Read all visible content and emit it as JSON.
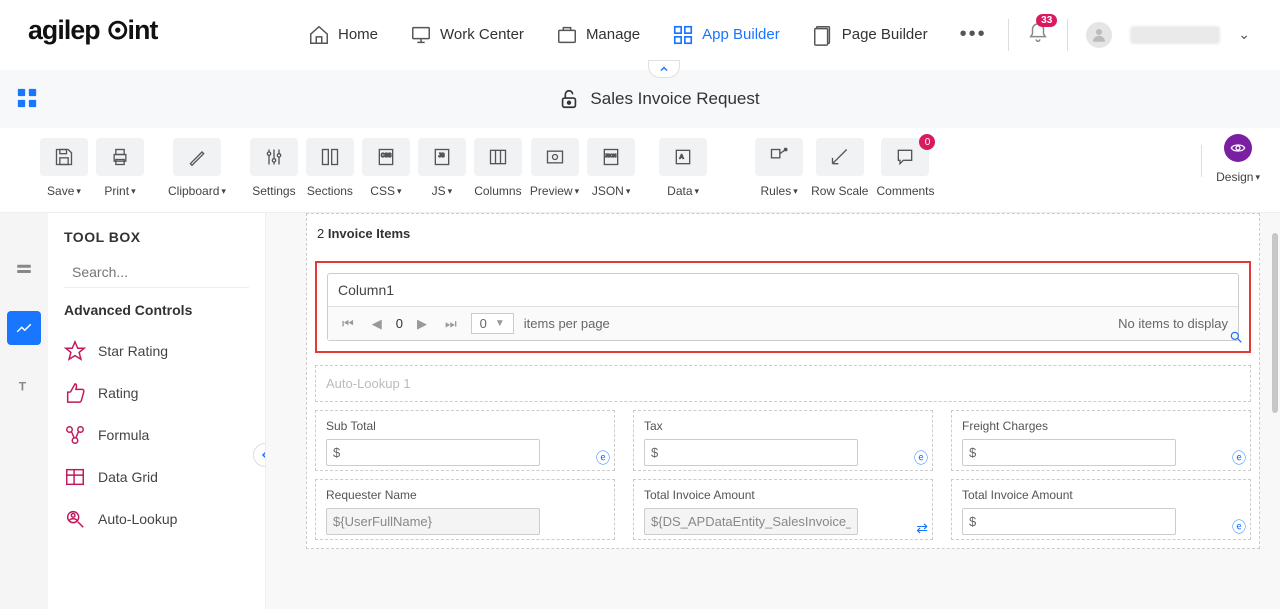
{
  "nav": {
    "home": "Home",
    "workcenter": "Work Center",
    "manage": "Manage",
    "appbuilder": "App Builder",
    "pagebuilder": "Page Builder",
    "bell_count": "33"
  },
  "page": {
    "title": "Sales Invoice Request"
  },
  "toolbar": {
    "save": "Save",
    "print": "Print",
    "clipboard": "Clipboard",
    "settings": "Settings",
    "sections": "Sections",
    "css": "CSS",
    "js": "JS",
    "columns": "Columns",
    "preview": "Preview",
    "json": "JSON",
    "data": "Data",
    "rules": "Rules",
    "rowscale": "Row Scale",
    "comments": "Comments",
    "comments_badge": "0",
    "design": "Design"
  },
  "sidebar": {
    "title": "TOOL BOX",
    "search_ph": "Search...",
    "section": "Advanced Controls",
    "items": [
      "Star Rating",
      "Rating",
      "Formula",
      "Data Grid",
      "Auto-Lookup"
    ]
  },
  "form": {
    "section_num": "2",
    "section_name": "Invoice Items",
    "grid": {
      "col1": "Column1",
      "page_current": "0",
      "page_size": "0",
      "per_page": "items per page",
      "empty": "No items to display"
    },
    "autolookup_ph": "Auto-Lookup 1",
    "row1": {
      "subtotal_label": "Sub Total",
      "subtotal_val": "$",
      "tax_label": "Tax",
      "tax_val": "$",
      "freight_label": "Freight Charges",
      "freight_val": "$"
    },
    "row2": {
      "req_label": "Requester Name",
      "req_val": "${UserFullName}",
      "tia_label": "Total Invoice Amount",
      "tia_val": "${DS_APDataEntity_SalesInvoice_Sub",
      "tia2_label": "Total Invoice Amount",
      "tia2_val": "$"
    }
  }
}
